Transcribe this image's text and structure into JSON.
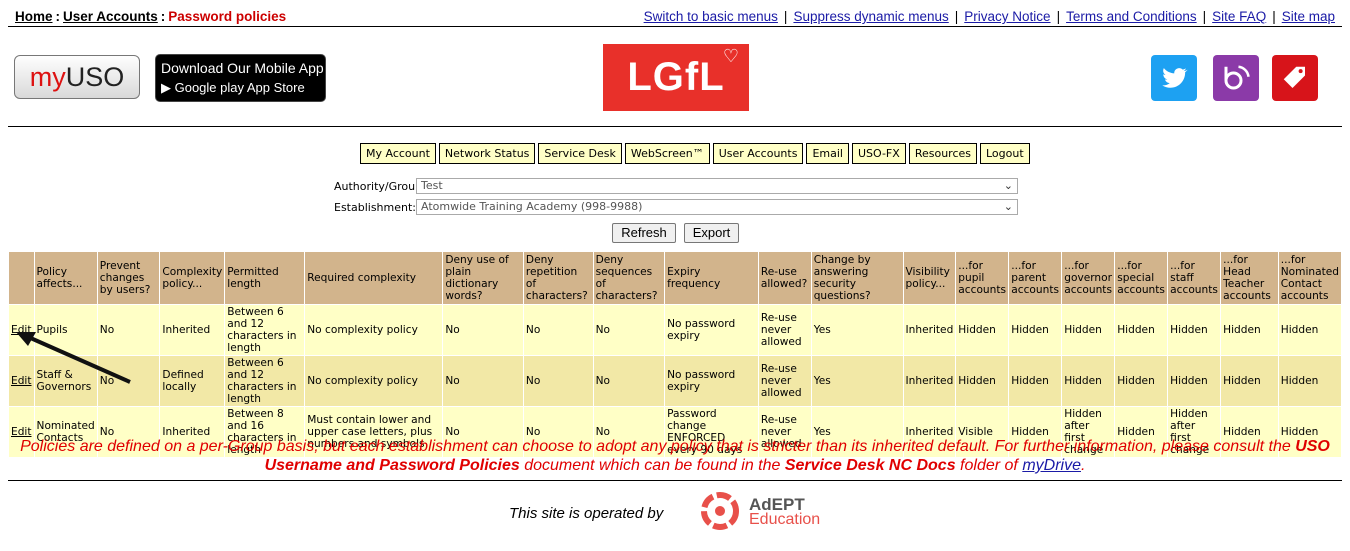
{
  "breadcrumb": {
    "home": "Home",
    "accounts": "User Accounts",
    "current": "Password policies"
  },
  "top_links": [
    "Switch to basic menus",
    "Suppress dynamic menus",
    "Privacy Notice",
    "Terms and Conditions",
    "Site FAQ",
    "Site map"
  ],
  "banner": {
    "myuso_my": "my",
    "myuso_uso": "USO",
    "app_line1": "Download Our Mobile App",
    "app_line2": "▶ Google play  App Store",
    "lgfl": "LGfL"
  },
  "nav": [
    "My Account",
    "Network Status",
    "Service Desk",
    "WebScreen™",
    "User Accounts",
    "Email",
    "USO-FX",
    "Resources",
    "Logout"
  ],
  "authority": {
    "label": "Authority/Group:",
    "value": "Test"
  },
  "establishment": {
    "label": "Establishment:",
    "value": "Atomwide Training Academy (998-9988)"
  },
  "buttons": {
    "refresh": "Refresh",
    "export": "Export"
  },
  "table": {
    "headers": [
      "",
      "Policy affects...",
      "Prevent changes by users?",
      "Complexity policy...",
      "Permitted length",
      "Required complexity",
      "Deny use of plain dictionary words?",
      "Deny repetition of characters?",
      "Deny sequences of characters?",
      "Expiry frequency",
      "Re-use allowed?",
      "Change by answering security questions?",
      "Visibility policy...",
      "...for pupil accounts",
      "...for parent accounts",
      "...for governor accounts",
      "...for special accounts",
      "...for staff accounts",
      "...for Head Teacher accounts",
      "...for Nominated Contact accounts"
    ],
    "rows": [
      [
        "Edit",
        "Pupils",
        "No",
        "Inherited",
        "Between 6 and 12 characters in length",
        "No complexity policy",
        "No",
        "No",
        "No",
        "No password expiry",
        "Re-use never allowed",
        "Yes",
        "Inherited",
        "Hidden",
        "Hidden",
        "Hidden",
        "Hidden",
        "Hidden",
        "Hidden",
        "Hidden"
      ],
      [
        "Edit",
        "Staff & Governors",
        "No",
        "Defined locally",
        "Between 6 and 12 characters in length",
        "No complexity policy",
        "No",
        "No",
        "No",
        "No password expiry",
        "Re-use never allowed",
        "Yes",
        "Inherited",
        "Hidden",
        "Hidden",
        "Hidden",
        "Hidden",
        "Hidden",
        "Hidden",
        "Hidden"
      ],
      [
        "Edit",
        "Nominated Contacts",
        "No",
        "Inherited",
        "Between 8 and 16 characters in length",
        "Must contain lower and upper case letters, plus numbers and symbols",
        "No",
        "No",
        "No",
        "Password change ENFORCED every 90 days",
        "Re-use never allowed",
        "Yes",
        "Inherited",
        "Visible",
        "Hidden",
        "Hidden after first change",
        "Hidden",
        "Hidden after first change",
        "Hidden",
        "Hidden"
      ]
    ]
  },
  "note": {
    "p1": "Policies are defined on a per-Group basis, but each establishment can choose to adopt any policy that is stricter than its inherited default. For further information, please consult the ",
    "b1": "USO Username and Password Policies",
    "p2": " document which can be found in the ",
    "b2": "Service Desk NC Docs",
    "p3": " folder of ",
    "link": "myDrive",
    "p4": "."
  },
  "footer": {
    "operated": "This site is operated by",
    "adept1": "AdEPT",
    "adept2": "Education"
  },
  "colors": {
    "header_bg": "#d2b48c",
    "row_odd": "#ffffc6",
    "row_even": "#f2e8a6",
    "note": "#e00000",
    "lgfl": "#e8302a"
  }
}
